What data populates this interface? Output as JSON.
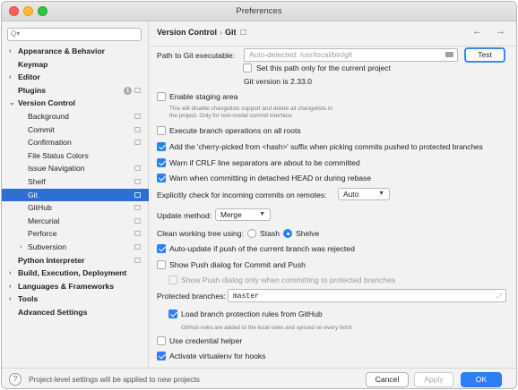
{
  "window": {
    "title": "Preferences",
    "colors": {
      "close": "#ff5f57",
      "minimize": "#febc2e",
      "maximize": "#28c840",
      "accent": "#2e6fd3"
    }
  },
  "sidebar": {
    "search_placeholder": "Q▾",
    "items": [
      {
        "label": "Appearance & Behavior",
        "arrow": "›"
      },
      {
        "label": "Keymap",
        "arrow": ""
      },
      {
        "label": "Editor",
        "arrow": "›"
      },
      {
        "label": "Plugins",
        "arrow": "",
        "badge": "1"
      },
      {
        "label": "Version Control",
        "arrow": "⌄"
      },
      {
        "label": "Background"
      },
      {
        "label": "Commit"
      },
      {
        "label": "Confirmation"
      },
      {
        "label": "File Status Colors"
      },
      {
        "label": "Issue Navigation"
      },
      {
        "label": "Shelf"
      },
      {
        "label": "Git",
        "selected": true
      },
      {
        "label": "GitHub"
      },
      {
        "label": "Mercurial"
      },
      {
        "label": "Perforce"
      },
      {
        "label": "Subversion",
        "arrow": "›"
      },
      {
        "label": "Python Interpreter"
      },
      {
        "label": "Build, Execution, Deployment",
        "arrow": "›"
      },
      {
        "label": "Languages & Frameworks",
        "arrow": "›"
      },
      {
        "label": "Tools",
        "arrow": "›"
      },
      {
        "label": "Advanced Settings"
      }
    ]
  },
  "header": {
    "crumb_parent": "Version Control",
    "crumb_sep": "›",
    "crumb_current": "Git",
    "nav": "← →"
  },
  "git": {
    "path_label": "Path to Git executable:",
    "path_placeholder": "Auto-detected: /usr/local/bin/git",
    "test_button": "Test",
    "set_path_only_project": "Set this path only for the current project",
    "version": "Git version is 2.33.0",
    "enable_staging": "Enable staging area",
    "staging_hint_1": "This will disable changelists support and delete all changelists in",
    "staging_hint_2": "the project. Only for non-modal commit interface.",
    "execute_branch_ops": "Execute branch operations on all roots",
    "cherry_picked": "Add the 'cherry-picked from <hash>' suffix when picking commits pushed to protected branches",
    "warn_crlf": "Warn if CRLF line separators are about to be committed",
    "warn_detached": "Warn when committing in detached HEAD or during rebase",
    "incoming_label": "Explicitly check for incoming commits on remotes:",
    "incoming_value": "Auto",
    "update_method_label": "Update method:",
    "update_method_value": "Merge",
    "clean_tree_label": "Clean working tree using:",
    "stash": "Stash",
    "shelve": "Shelve",
    "auto_update": "Auto-update if push of the current branch was rejected",
    "show_push_dialog": "Show Push dialog for Commit and Push",
    "show_push_protected": "Show Push dialog only when committing to protected branches",
    "protected_label": "Protected branches:",
    "protected_value": "master",
    "load_protection": "Load branch protection rules from GitHub",
    "load_protection_hint": "GitHub rules are added to the local rules and synced on every fetch",
    "credential_helper": "Use credential helper",
    "activate_virtualenv": "Activate virtualenv for hooks"
  },
  "checkbox_state": {
    "set_path_only_project": false,
    "enable_staging": false,
    "execute_branch_ops": false,
    "cherry_picked": true,
    "warn_crlf": true,
    "warn_detached": true,
    "auto_update": true,
    "show_push_dialog": false,
    "show_push_protected": false,
    "load_protection": true,
    "credential_helper": false,
    "activate_virtualenv": true
  },
  "footer": {
    "help": "?",
    "note": "Project-level settings will be applied to new projects",
    "cancel": "Cancel",
    "apply": "Apply",
    "ok": "OK"
  }
}
